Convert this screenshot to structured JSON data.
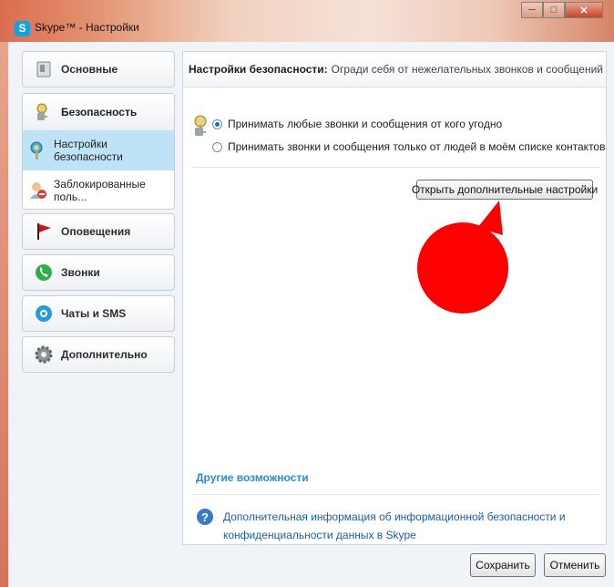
{
  "window": {
    "title": "Skype™ - Настройки",
    "controls": [
      "minimize",
      "maximize",
      "close"
    ]
  },
  "sidebar": {
    "general": "Основные",
    "security": "Безопасность",
    "security_items": [
      {
        "label": "Настройки безопасности",
        "active": true
      },
      {
        "label": "Заблокированные поль...",
        "active": false
      }
    ],
    "notifications": "Оповещения",
    "calls": "Звонки",
    "chats": "Чаты и SMS",
    "advanced": "Дополнительно"
  },
  "content": {
    "header_bold": "Настройки безопасности:",
    "header_text": "Огради себя от нежелательных звонков и сообщений",
    "radio_1": "Принимать любые звонки и сообщения от кого угодно",
    "radio_2": "Принимать звонки и сообщения только от людей в моём списке контактов",
    "selected_radio": 1,
    "advanced_button": "Открыть дополнительные настройки",
    "other_title": "Другие возможности",
    "info_line1": "Дополнительная информация об информационной безопасности и",
    "info_line2": "конфиденциальности данных в Skype"
  },
  "footer": {
    "save": "Сохранить",
    "cancel": "Отменить"
  },
  "colors": {
    "accent_link": "#2a8ad6",
    "active_item_bg": "#bfe3f6",
    "annotation_red": "#ff0000"
  }
}
